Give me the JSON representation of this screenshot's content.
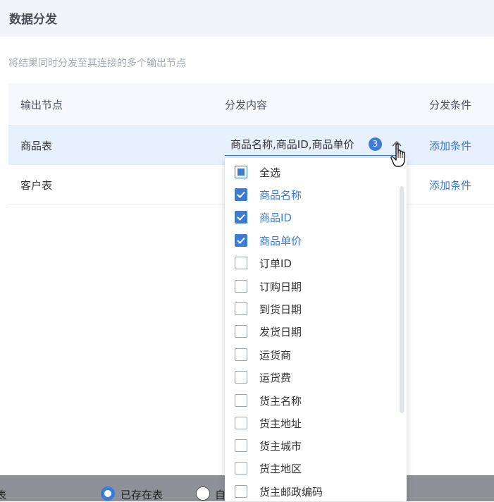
{
  "header": {
    "title": "数据分发"
  },
  "description": "将结果同时分发至其连接的多个输出节点",
  "table": {
    "columns": [
      "输出节点",
      "分发内容",
      "分发条件"
    ],
    "rows": [
      {
        "node": "商品表",
        "content": "商品名称,商品ID,商品单价",
        "count": "3",
        "condition": "添加条件"
      },
      {
        "node": "客户表",
        "content": "",
        "condition": "添加条件"
      }
    ]
  },
  "dropdown": {
    "options": [
      {
        "label": "全选",
        "state": "partial"
      },
      {
        "label": "商品名称",
        "state": "checked"
      },
      {
        "label": "商品ID",
        "state": "checked"
      },
      {
        "label": "商品单价",
        "state": "checked"
      },
      {
        "label": "订单ID",
        "state": "unchecked"
      },
      {
        "label": "订购日期",
        "state": "unchecked"
      },
      {
        "label": "到货日期",
        "state": "unchecked"
      },
      {
        "label": "发货日期",
        "state": "unchecked"
      },
      {
        "label": "运货商",
        "state": "unchecked"
      },
      {
        "label": "运货费",
        "state": "unchecked"
      },
      {
        "label": "货主名称",
        "state": "unchecked"
      },
      {
        "label": "货主地址",
        "state": "unchecked"
      },
      {
        "label": "货主城市",
        "state": "unchecked"
      },
      {
        "label": "货主地区",
        "state": "unchecked"
      },
      {
        "label": "货主邮政编码",
        "state": "unchecked"
      }
    ]
  },
  "footer": {
    "label_fragment": "表",
    "radio_existing": "已存在表",
    "radio_other_fragment": "自"
  },
  "colors": {
    "accent": "#3a7cd6",
    "header_bg": "#f3f4f7",
    "row_active": "#e7f0fd"
  }
}
